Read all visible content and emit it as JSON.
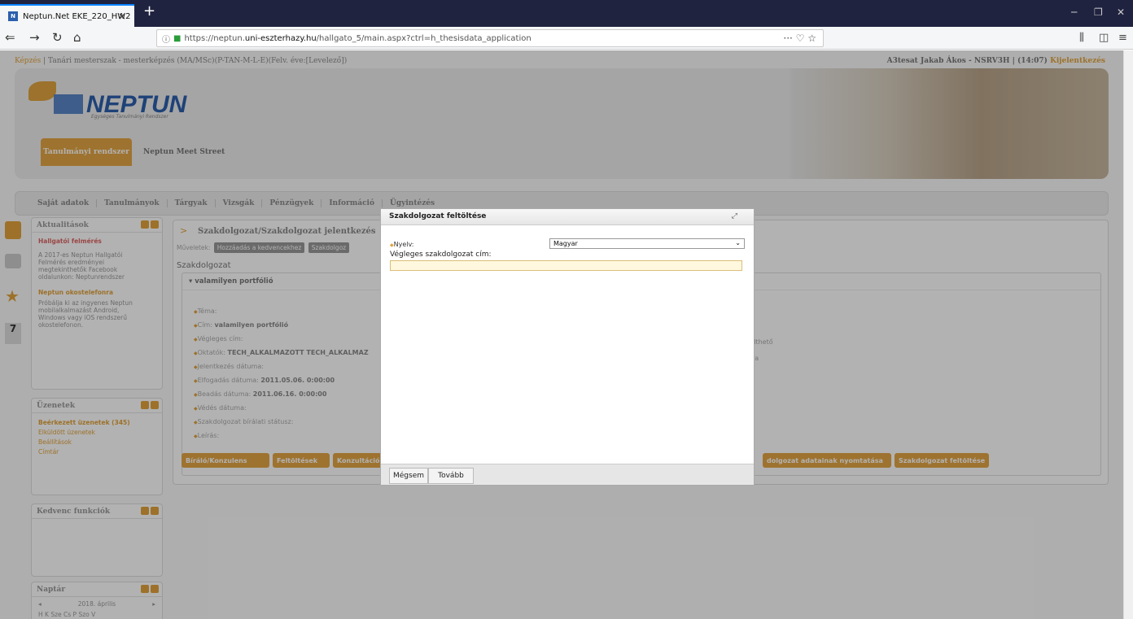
{
  "browser": {
    "tab_title": "Neptun.Net EKE_220_HW2",
    "tab_close": "×",
    "new_tab": "+",
    "url_prefix": "https://neptun.",
    "url_domain": "uni-eszterhazy.hu",
    "url_path": "/hallgato_5/main.aspx?ctrl=h_thesisdata_application",
    "page_actions": "··· ♡ ☆"
  },
  "page": {
    "program_label": "Képzés",
    "program_text": " | Tanári mesterszak - mesterképzés (MA/MSc)(P-TAN-M-L-E)(Felv. éve:[Levelező])",
    "user_text": "A3tesat Jakab Ákos - NSRV3H | (14:07)",
    "logout_label": "Kijelentkezés",
    "logo_text": "NEPTUN",
    "logo_sub": "Egységes Tanulmányi Rendszer",
    "nav_active": "Tanulmányi rendszer",
    "nav_other": "Neptun Meet Street",
    "menu": [
      "Saját adatok",
      "Tanulmányok",
      "Tárgyak",
      "Vizsgák",
      "Pénzügyek",
      "Információ",
      "Ügyintézés"
    ]
  },
  "sidebar": {
    "news_title": "Aktualitások",
    "news_item_title": "Hallgatói felmérés",
    "news_item_lines": [
      "A 2017-es Neptun Hallgatói",
      "Felmérés eredményei",
      "megtekinthetők Facebook",
      "oldalunkon: Neptunrendszer"
    ],
    "phone_title": "Neptun okostelefonra",
    "phone_lines": [
      "Próbálja ki az ingyenes Neptun",
      "mobilalkalmazást Android,",
      "Windows vagy iOS rendszerű",
      "okostelefonon."
    ],
    "messages_title": "Üzenetek",
    "messages_items": [
      "Beérkezett üzenetek (345)",
      "Elküldött üzenetek",
      "Beállítások",
      "Címtár"
    ],
    "favorites_title": "Kedvenc funkciók",
    "calendar_title": "Naptár",
    "calendar_month": "2018. április",
    "calendar_days": "H  K  Sze  Cs  P  Szo  V"
  },
  "content": {
    "title": "Szakdolgozat/Szakdolgozat jelentkezés",
    "actions_label": "Műveletek:",
    "action_fav": "Hozzáadás a kedvencekhez",
    "action_2": "Szakdolgoz",
    "section": "Szakdolgozat",
    "portfolio": "valamilyen portfólió",
    "details": [
      {
        "label": "Téma:",
        "value": ""
      },
      {
        "label": "Cím:",
        "value": "valamilyen portfólió"
      },
      {
        "label": "Végleges cím:",
        "value": ""
      },
      {
        "label": "Oktatók:",
        "value": "TECH_ALKALMAZOTT TECH_ALKALMAZ"
      },
      {
        "label": "Jelentkezés dátuma:",
        "value": ""
      },
      {
        "label": "Elfogadás dátuma:",
        "value": "2011.05.06. 0:00:00"
      },
      {
        "label": "Beadás dátuma:",
        "value": "2011.06.16. 0:00:00"
      },
      {
        "label": "Védés dátuma:",
        "value": ""
      },
      {
        "label": "Szakdolgozat bírálati státusz:",
        "value": ""
      },
      {
        "label": "Leírás:",
        "value": ""
      }
    ],
    "right_text_1": "ilthető",
    "right_text_2": "ra",
    "btn_biralo": "Bíráló/Konzulens",
    "btn_2": "Feltöltések",
    "btn_3": "Konzultációk",
    "btn_print": "dolgozat adatainak nyomtatása",
    "btn_last": "Szakdolgozat feltöltése"
  },
  "dialog": {
    "title": "Szakdolgozat feltöltése",
    "max_icon": "⤢",
    "lang_label": "Nyelv:",
    "lang_value": "Magyar",
    "final_title_label": "Végleges szakdolgozat cím:",
    "final_title_value": "",
    "cancel_label": "Mégsem",
    "next_label": "Tovább"
  }
}
